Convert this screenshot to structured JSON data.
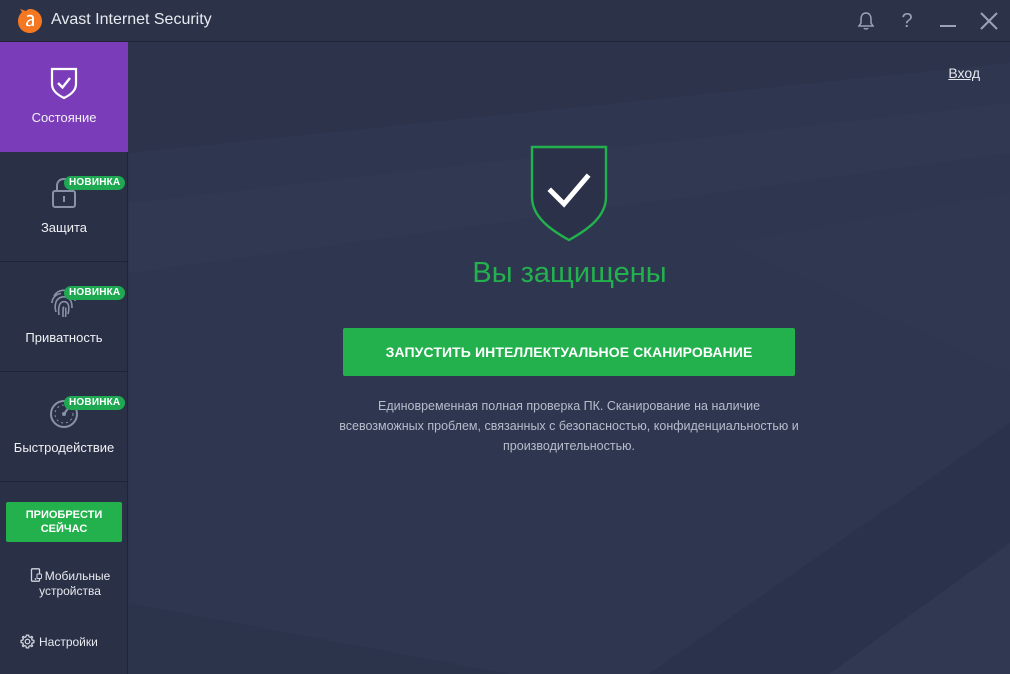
{
  "window": {
    "title": "Avast Internet Security",
    "logo_icon": "avast-logo-icon",
    "controls": {
      "notifications_icon": "bell-icon",
      "help_label": "?",
      "minimize_icon": "minimize-icon",
      "close_icon": "close-icon"
    }
  },
  "sidebar": {
    "items": [
      {
        "label": "Состояние",
        "icon": "shield-check-icon",
        "active": true,
        "badge": ""
      },
      {
        "label": "Защита",
        "icon": "lock-icon",
        "active": false,
        "badge": "НОВИНКА"
      },
      {
        "label": "Приватность",
        "icon": "fingerprint-icon",
        "active": false,
        "badge": "НОВИНКА"
      },
      {
        "label": "Быстродействие",
        "icon": "speedometer-icon",
        "active": false,
        "badge": "НОВИНКА"
      }
    ],
    "buy_button": "ПРИОБРЕСТИ СЕЙЧАС",
    "mobile_label": "Мобильные устройства",
    "settings_label": "Настройки"
  },
  "main": {
    "login_label": "Вход",
    "status_title": "Вы защищены",
    "scan_button": "ЗАПУСТИТЬ ИНТЕЛЛЕКТУАЛЬНОЕ СКАНИРОВАНИЕ",
    "scan_description": "Единовременная полная проверка ПК. Сканирование на наличие всевозможных проблем, связанных с безопасностью, конфиденциальностью и производительностью."
  },
  "colors": {
    "accent_green": "#22b14c",
    "active_purple": "#7b3cba",
    "background": "#2f3650",
    "sidebar": "#2a3045",
    "logo_orange": "#f47721"
  }
}
